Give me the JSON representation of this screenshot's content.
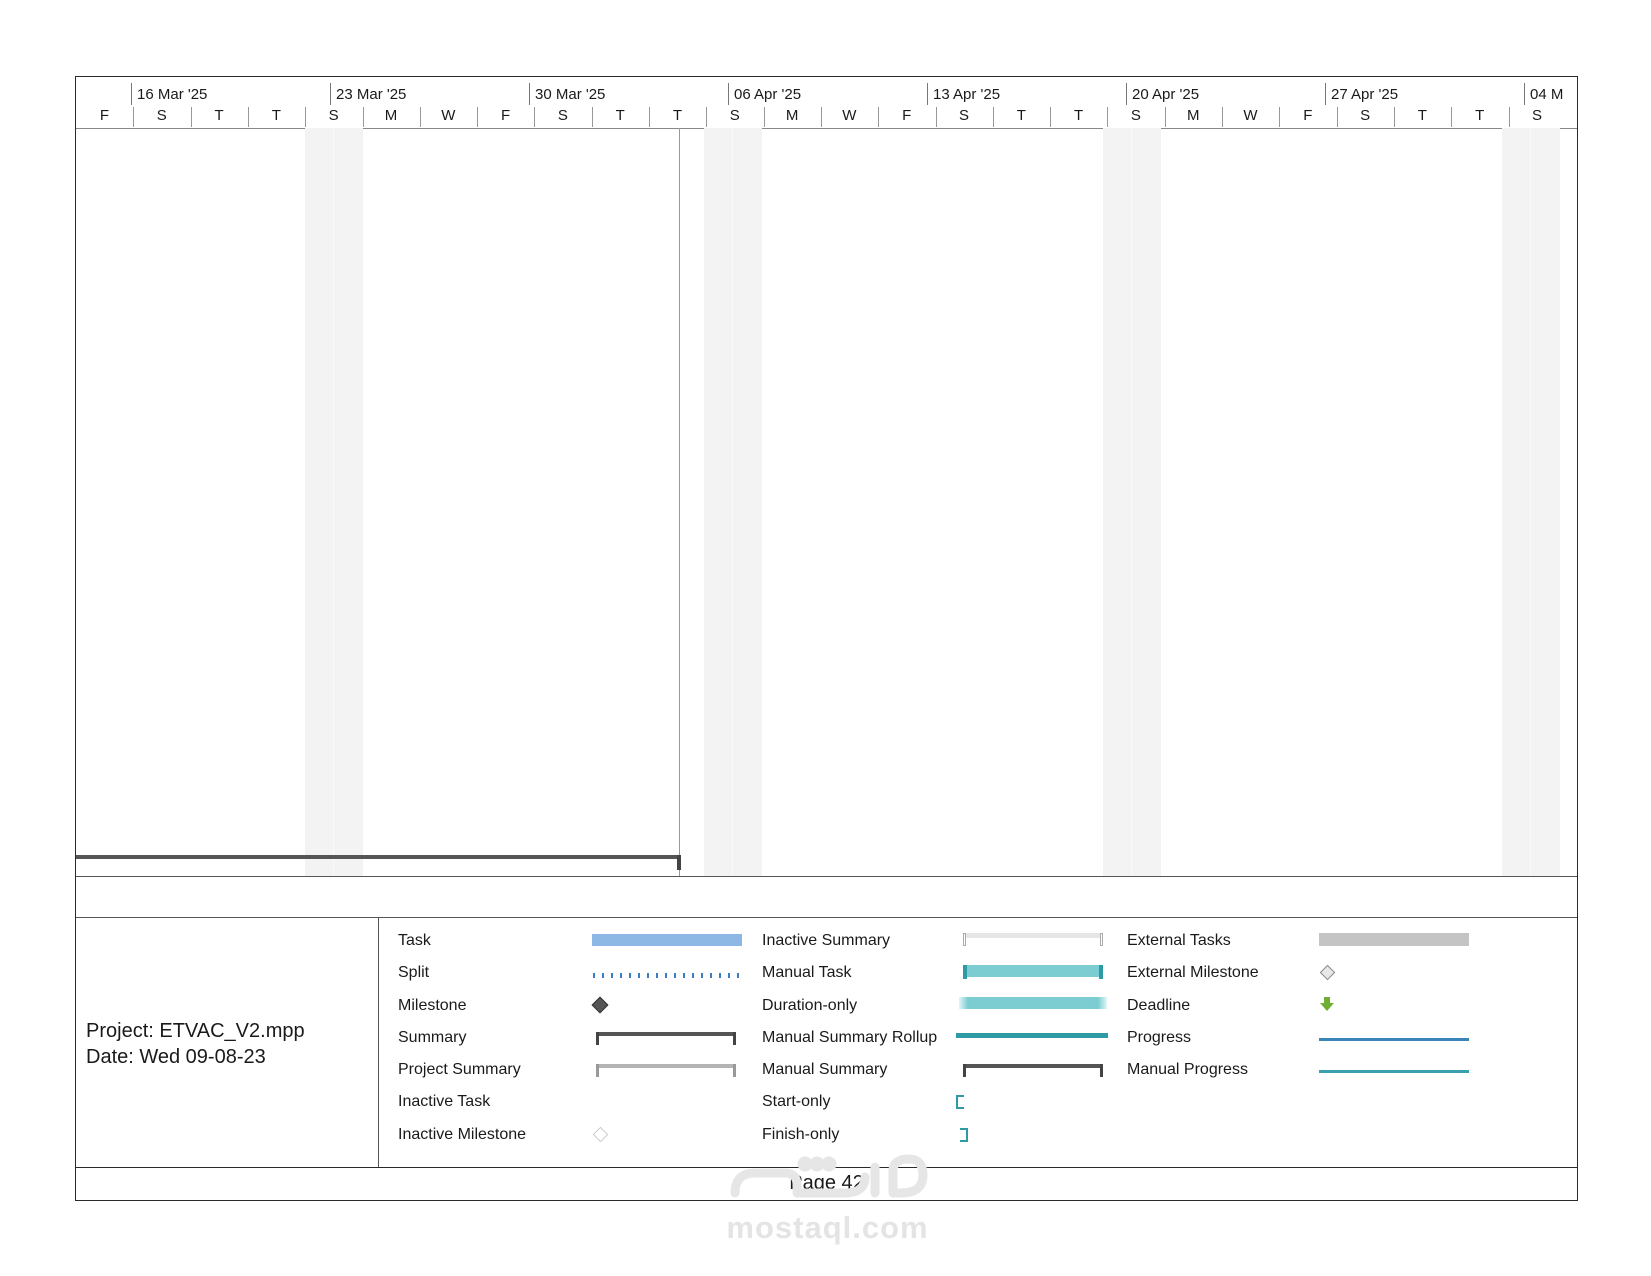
{
  "timescale": {
    "weeks": [
      "16 Mar '25",
      "23 Mar '25",
      "30 Mar '25",
      "06 Apr '25",
      "13 Apr '25",
      "20 Apr '25",
      "27 Apr '25",
      "04 M"
    ],
    "days": [
      "F",
      "S",
      "T",
      "T",
      "S",
      "M",
      "W",
      "F",
      "S",
      "T",
      "T",
      "S",
      "M",
      "W",
      "F",
      "S",
      "T",
      "T",
      "S",
      "M",
      "W",
      "F",
      "S",
      "T",
      "T",
      "S"
    ]
  },
  "project": {
    "name_line": "Project: ETVAC_V2.mpp",
    "date_line": "Date: Wed 09-08-23"
  },
  "legend": {
    "col1": [
      "Task",
      "Split",
      "Milestone",
      "Summary",
      "Project Summary",
      "Inactive Task",
      "Inactive Milestone"
    ],
    "col2": [
      "Inactive Summary",
      "Manual Task",
      "Duration-only",
      "Manual Summary Rollup",
      "Manual Summary",
      "Start-only",
      "Finish-only"
    ],
    "col3": [
      "External Tasks",
      "External Milestone",
      "Deadline",
      "Progress",
      "Manual Progress"
    ]
  },
  "colors": {
    "task": "#8db8e6",
    "split": "#3c7ebf",
    "manual_task": "#7ccdd1",
    "manual_accent": "#2d9aa4",
    "summary": "#555555",
    "project_summary": "#b4b4b4",
    "external_task": "#c4c4c4",
    "deadline": "#6fae32",
    "progress": "#3b86b8"
  },
  "footer": {
    "page": "Page 42"
  },
  "watermark": {
    "text": "mostaql.com"
  }
}
